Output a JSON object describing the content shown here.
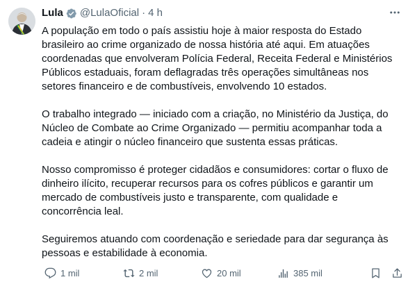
{
  "author": {
    "name": "Lula",
    "handle": "@LulaOficial",
    "separator": "·",
    "time": "4 h"
  },
  "tweet": {
    "paragraphs": [
      "A população em todo o país assistiu hoje à maior resposta do Estado brasileiro ao crime organizado de nossa história até aqui. Em atuações coordenadas que envolveram Polícia Federal, Receita Federal e  Ministérios Públicos estaduais, foram deflagradas três operações simultâneas nos setores financeiro e de combustíveis, envolvendo 10 estados.",
      "O trabalho integrado — iniciado com a criação, no Ministério da Justiça, do Núcleo de Combate ao Crime Organizado — permitiu acompanhar toda a cadeia e atingir o núcleo financeiro que sustenta essas práticas.",
      "Nosso compromisso é proteger cidadãos e consumidores: cortar o fluxo de dinheiro ilícito, recuperar recursos para os cofres públicos e garantir um mercado de combustíveis justo e transparente, com qualidade e concorrência leal.",
      "Seguiremos atuando com coordenação e seriedade para dar segurança às pessoas e estabilidade à economia."
    ]
  },
  "actions": {
    "replies": "1 mil",
    "reposts": "2 mil",
    "likes": "20 mil",
    "views": "385 mil"
  },
  "icons": {
    "verified": "verified-badge-icon",
    "more": "more-options-icon",
    "reply": "reply-icon",
    "repost": "repost-icon",
    "like": "like-icon",
    "views": "views-icon",
    "bookmark": "bookmark-icon",
    "share": "share-icon"
  },
  "colors": {
    "text": "#0f1419",
    "secondary": "#536471",
    "verified": "#829aab"
  }
}
